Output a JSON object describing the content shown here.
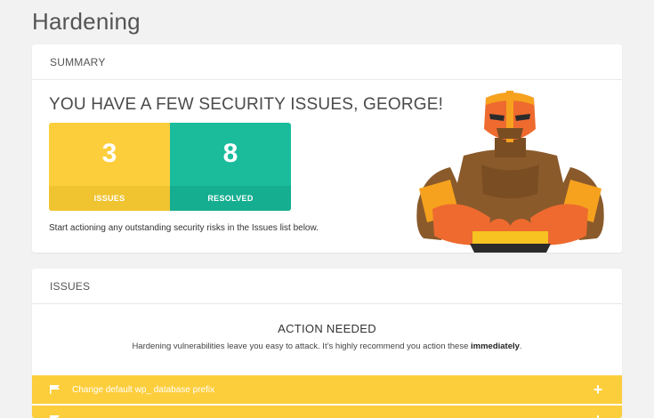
{
  "page": {
    "title": "Hardening"
  },
  "summary": {
    "header": "SUMMARY",
    "title": "YOU HAVE A FEW SECURITY ISSUES, GEORGE!",
    "stats": [
      {
        "value": "3",
        "label": "ISSUES",
        "color": "#fdce3c"
      },
      {
        "value": "8",
        "label": "RESOLVED",
        "color": "#1abc9c"
      }
    ],
    "note": "Start actioning any outstanding security risks in the Issues list below."
  },
  "issues": {
    "header": "ISSUES",
    "action_title": "ACTION NEEDED",
    "action_text": "Hardening vulnerabilities leave you easy to attack. It’s highly recommend you action these ",
    "action_emphasis": "immediately",
    "action_end": ".",
    "items": [
      {
        "label": "Change default wp_ database prefix",
        "icon": "flag-icon",
        "expand_icon": "plus-icon",
        "color": "#fdce3c"
      },
      {
        "label": "",
        "icon": "flag-icon",
        "expand_icon": "plus-icon",
        "color": "#fdce3c"
      }
    ]
  }
}
